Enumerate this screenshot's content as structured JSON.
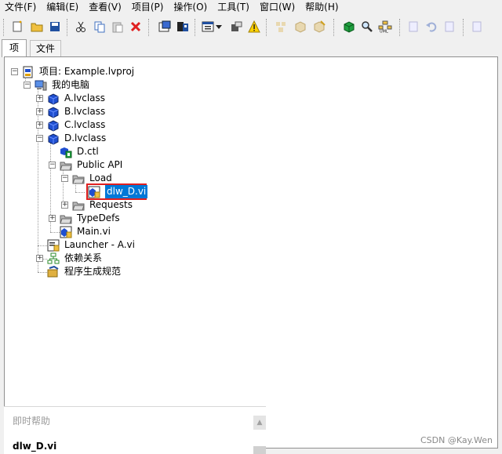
{
  "menubar": {
    "items": [
      "文件(F)",
      "编辑(E)",
      "查看(V)",
      "项目(P)",
      "操作(O)",
      "工具(T)",
      "窗口(W)",
      "帮助(H)"
    ]
  },
  "toolbar": {
    "icons": [
      "new-icon",
      "open-icon",
      "save-all-icon",
      "cut-icon",
      "copy-icon",
      "paste-icon",
      "delete-icon",
      "build-icon",
      "build-specs-icon",
      "view-options-icon",
      "dropdown-arrow-icon",
      "tools-icon",
      "warning-icon",
      "class-icon-1",
      "class-icon-2",
      "class-icon-3",
      "green-cube-icon",
      "search-icon",
      "uml-icon",
      "doc-icon-1",
      "undo-icon",
      "doc-icon-2",
      "doc-icon-3"
    ]
  },
  "tabs": [
    "项",
    "文件"
  ],
  "tree": {
    "project_label": "项目: Example.lvproj",
    "computer_label": "我的电脑",
    "nodes": [
      "A.lvclass",
      "B.lvclass",
      "C.lvclass",
      "D.lvclass",
      "D.ctl",
      "Public API",
      "Load",
      "dlw_D.vi",
      "Requests",
      "TypeDefs",
      "Main.vi",
      "Launcher - A.vi",
      "依赖关系",
      "程序生成规范"
    ]
  },
  "help": {
    "title": "即时帮助",
    "vi_name": "dlw_D.vi"
  },
  "watermark": "CSDN @Kay.Wen",
  "colors": {
    "selection": "#0078d7",
    "highlight_box": "#e02020",
    "class_cube": "#1f4fd0"
  }
}
